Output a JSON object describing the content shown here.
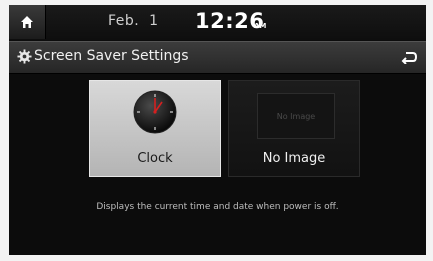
{
  "status": {
    "date": "Feb.  1",
    "time": "12:26",
    "ampm": "AM"
  },
  "header": {
    "title": "Screen Saver Settings"
  },
  "options": [
    {
      "label": "Clock",
      "selected": true
    },
    {
      "label": "No Image",
      "thumb_text": "No Image",
      "selected": false
    }
  ],
  "description": "Displays the current time and date when power is off.",
  "icons": {
    "home": "home-icon",
    "settings": "gear-icon",
    "back": "back-arrow-icon",
    "clock": "analog-clock-icon"
  },
  "colors": {
    "screen_bg": "#0c0c0c",
    "selected_tile": "#c8c8c8",
    "clock_hand": "#d42020"
  }
}
